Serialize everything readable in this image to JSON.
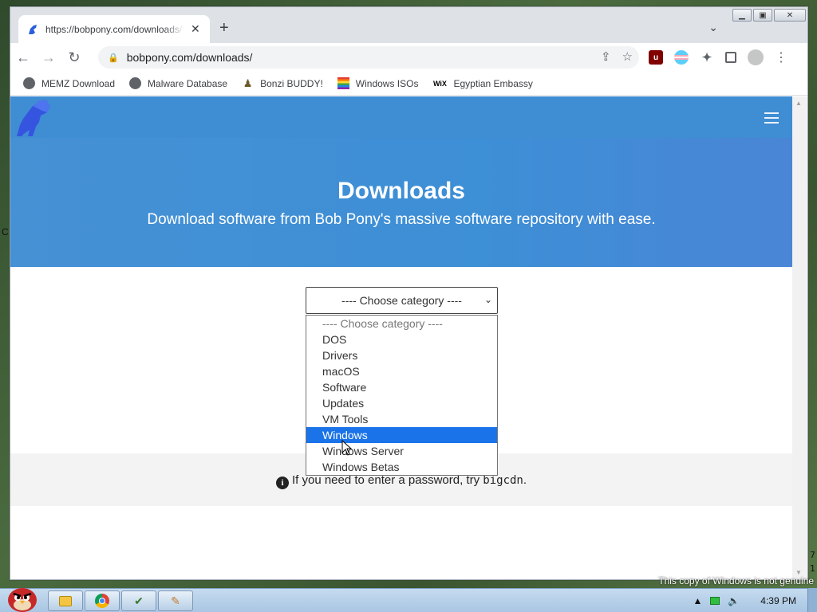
{
  "desktop": {
    "edge_letter": "C",
    "right_digits": [
      "7",
      "1"
    ],
    "genuine_notice": "This copy of Windows is not genuine"
  },
  "browser": {
    "tab": {
      "title": "https://bobpony.com/downloads/"
    },
    "omnibox": {
      "url": "bobpony.com/downloads/"
    },
    "bookmarks": [
      {
        "label": "MEMZ Download",
        "icon": "globe-icon"
      },
      {
        "label": "Malware Database",
        "icon": "globe-icon"
      },
      {
        "label": "Bonzi BUDDY!",
        "icon": "bonzi-icon"
      },
      {
        "label": "Windows ISOs",
        "icon": "rainbow-flag-icon"
      },
      {
        "label": "Egyptian Embassy",
        "icon": "wix-icon"
      }
    ],
    "extensions": [
      "ublock-icon",
      "trans-flag-icon",
      "puzzle-icon",
      "sidepanel-icon"
    ]
  },
  "page": {
    "hero": {
      "title": "Downloads",
      "subtitle": "Download software from Bob Pony's massive software repository with ease."
    },
    "category_select": {
      "selected": "---- Choose category ----",
      "options": [
        "---- Choose category ----",
        "DOS",
        "Drivers",
        "macOS",
        "Software",
        "Updates",
        "VM Tools",
        "Windows",
        "Windows Server",
        "Windows Betas"
      ],
      "highlighted": "Windows"
    },
    "info": {
      "text": "If you need to enter a password, try",
      "password": "bigcdn",
      "end": "."
    }
  },
  "taskbar": {
    "clock": "4:39 PM"
  },
  "colors": {
    "hero": "#3f8dd3",
    "highlight": "#1a73e8"
  }
}
